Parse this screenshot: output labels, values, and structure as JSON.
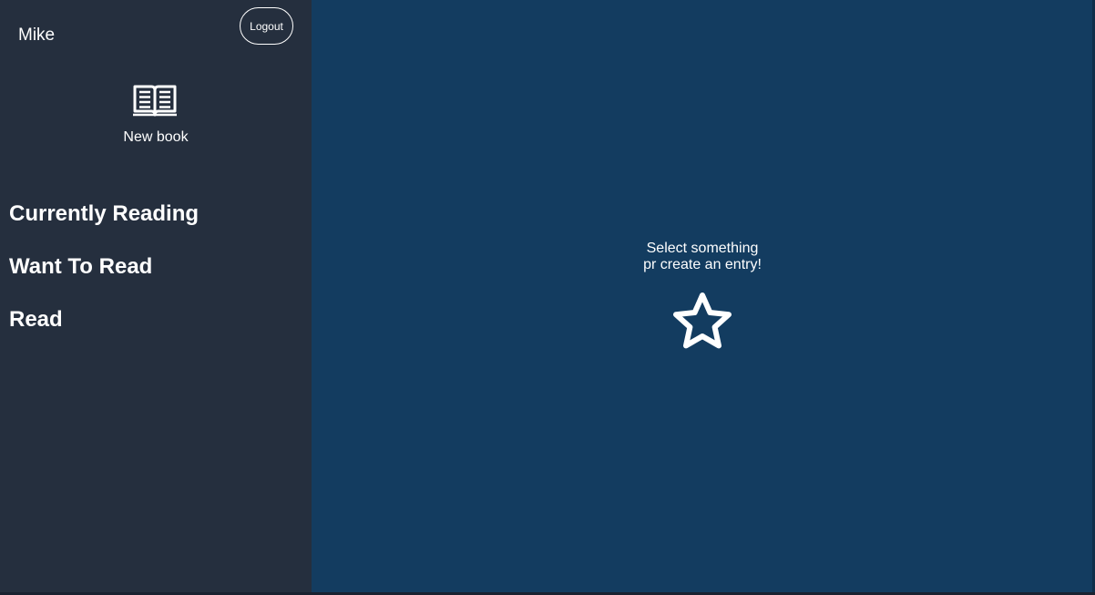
{
  "user": {
    "name": "Mike",
    "logout_label": "Logout"
  },
  "new_book": {
    "label": "New book",
    "icon": "book-open-icon"
  },
  "nav": {
    "items": [
      {
        "label": "Currently Reading"
      },
      {
        "label": "Want To Read"
      },
      {
        "label": "Read"
      }
    ]
  },
  "main": {
    "empty_line1": "Select something",
    "empty_line2": "pr create an entry!",
    "icon": "star-icon"
  },
  "colors": {
    "sidebar_bg": "#252f3e",
    "main_bg": "#133c60",
    "text": "#ffffff"
  }
}
